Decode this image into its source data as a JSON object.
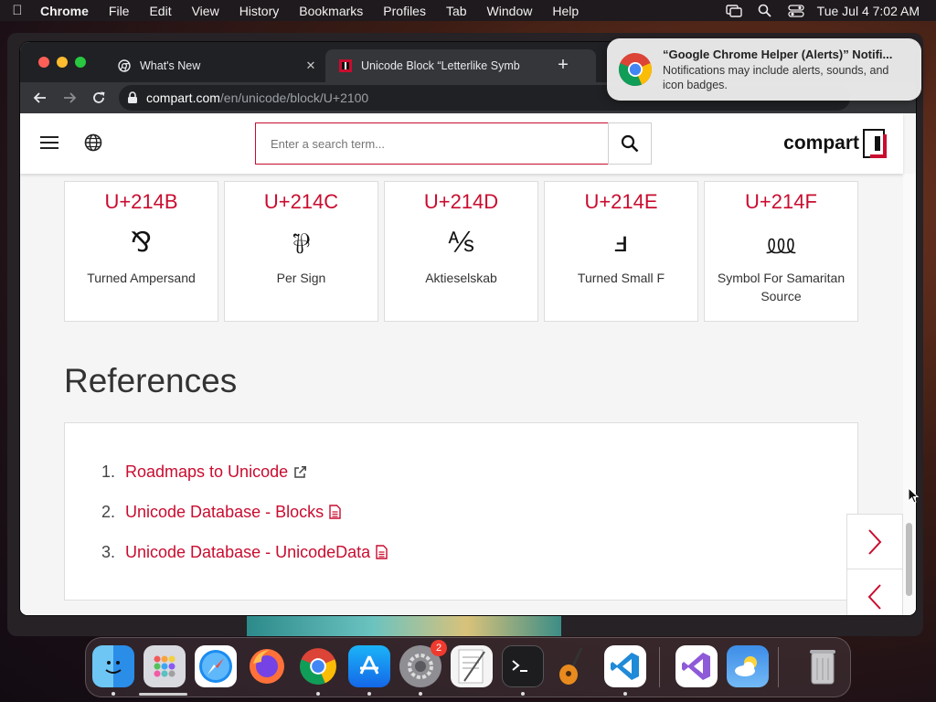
{
  "menubar": {
    "app_name": "Chrome",
    "items": [
      "File",
      "Edit",
      "View",
      "History",
      "Bookmarks",
      "Profiles",
      "Tab",
      "Window",
      "Help"
    ],
    "clock": "Tue Jul 4  7:02 AM"
  },
  "browser": {
    "tabs": [
      {
        "title": "What's New",
        "active": false
      },
      {
        "title": "Unicode Block “Letterlike Symb",
        "active": true
      }
    ],
    "url_host": "compart.com",
    "url_path": "/en/unicode/block/U+2100"
  },
  "site": {
    "search_placeholder": "Enter a search term...",
    "logo_text": "compart"
  },
  "characters": [
    {
      "code": "U+214B",
      "glyph": "⅋",
      "name": "Turned Ampersand"
    },
    {
      "code": "U+214C",
      "glyph": "⅌",
      "name": "Per Sign"
    },
    {
      "code": "U+214D",
      "glyph": "⅍",
      "name": "Aktieselskab"
    },
    {
      "code": "U+214E",
      "glyph": "ⅎ",
      "name": "Turned Small F"
    },
    {
      "code": "U+214F",
      "glyph": "⅏",
      "name": "Symbol For Samaritan Source"
    }
  ],
  "references": {
    "title": "References",
    "items": [
      {
        "number": "1.",
        "label": "Roadmaps to Unicode",
        "icon": "external-link-icon"
      },
      {
        "number": "2.",
        "label": "Unicode Database - Blocks",
        "icon": "document-icon"
      },
      {
        "number": "3.",
        "label": "Unicode Database - UnicodeData",
        "icon": "document-icon"
      }
    ]
  },
  "notification": {
    "title": "“Google Chrome Helper (Alerts)” Notifi...",
    "body": "Notifications may include alerts, sounds, and icon badges."
  },
  "dock": {
    "apps": [
      "Finder",
      "Launchpad",
      "Safari",
      "Firefox",
      "Chrome",
      "App Store",
      "System Settings",
      "TextEdit",
      "Terminal",
      "GarageBand",
      "Visual Studio Code",
      "Visual Studio",
      "Weather",
      "Trash"
    ],
    "settings_badge": "2"
  },
  "colors": {
    "accent": "#c90c2f",
    "chrome_dark": "#202124",
    "page_bg": "#f5f5f5"
  }
}
